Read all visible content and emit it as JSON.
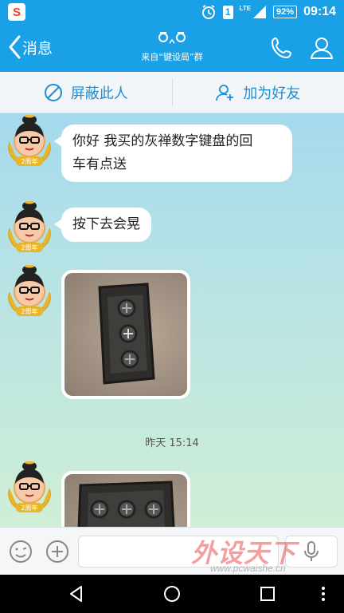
{
  "status_bar": {
    "app_icon": "sogou-icon",
    "app_glyph": "S",
    "alarm_icon": "alarm-icon",
    "sim_badge": "1",
    "network": "LTE",
    "battery": "92%",
    "time": "09:14"
  },
  "title_bar": {
    "back_label": "消息",
    "face": "ㅎㅅㅎ",
    "subtitle": "来自“键设局”群",
    "phone_icon": "phone-icon",
    "profile_icon": "person-icon"
  },
  "action_bar": {
    "block_label": "屏蔽此人",
    "add_friend_label": "加为好友"
  },
  "chat": {
    "avatar_badge": "2周年",
    "messages": [
      {
        "type": "text",
        "text_line1": "你好 我买的灰禅数字键盘的回",
        "text_line2": "车有点送"
      },
      {
        "type": "text",
        "text": "按下去会晃"
      },
      {
        "type": "image",
        "description": "keycap-photo"
      }
    ],
    "timestamp": "昨天 15:14"
  },
  "input_bar": {
    "emoji_icon": "emoji-icon",
    "plus_icon": "plus-icon",
    "mic_icon": "mic-icon",
    "placeholder": ""
  },
  "watermark": {
    "text": "外设天下",
    "url": "www.pcwaishe.cn"
  },
  "nav_bar": {
    "back": "back-triangle-icon",
    "home": "home-circle-icon",
    "recents": "recents-square-icon"
  },
  "colors": {
    "primary": "#1aa0e6",
    "accent_text": "#1a8fd6",
    "bubble": "#ffffff"
  }
}
